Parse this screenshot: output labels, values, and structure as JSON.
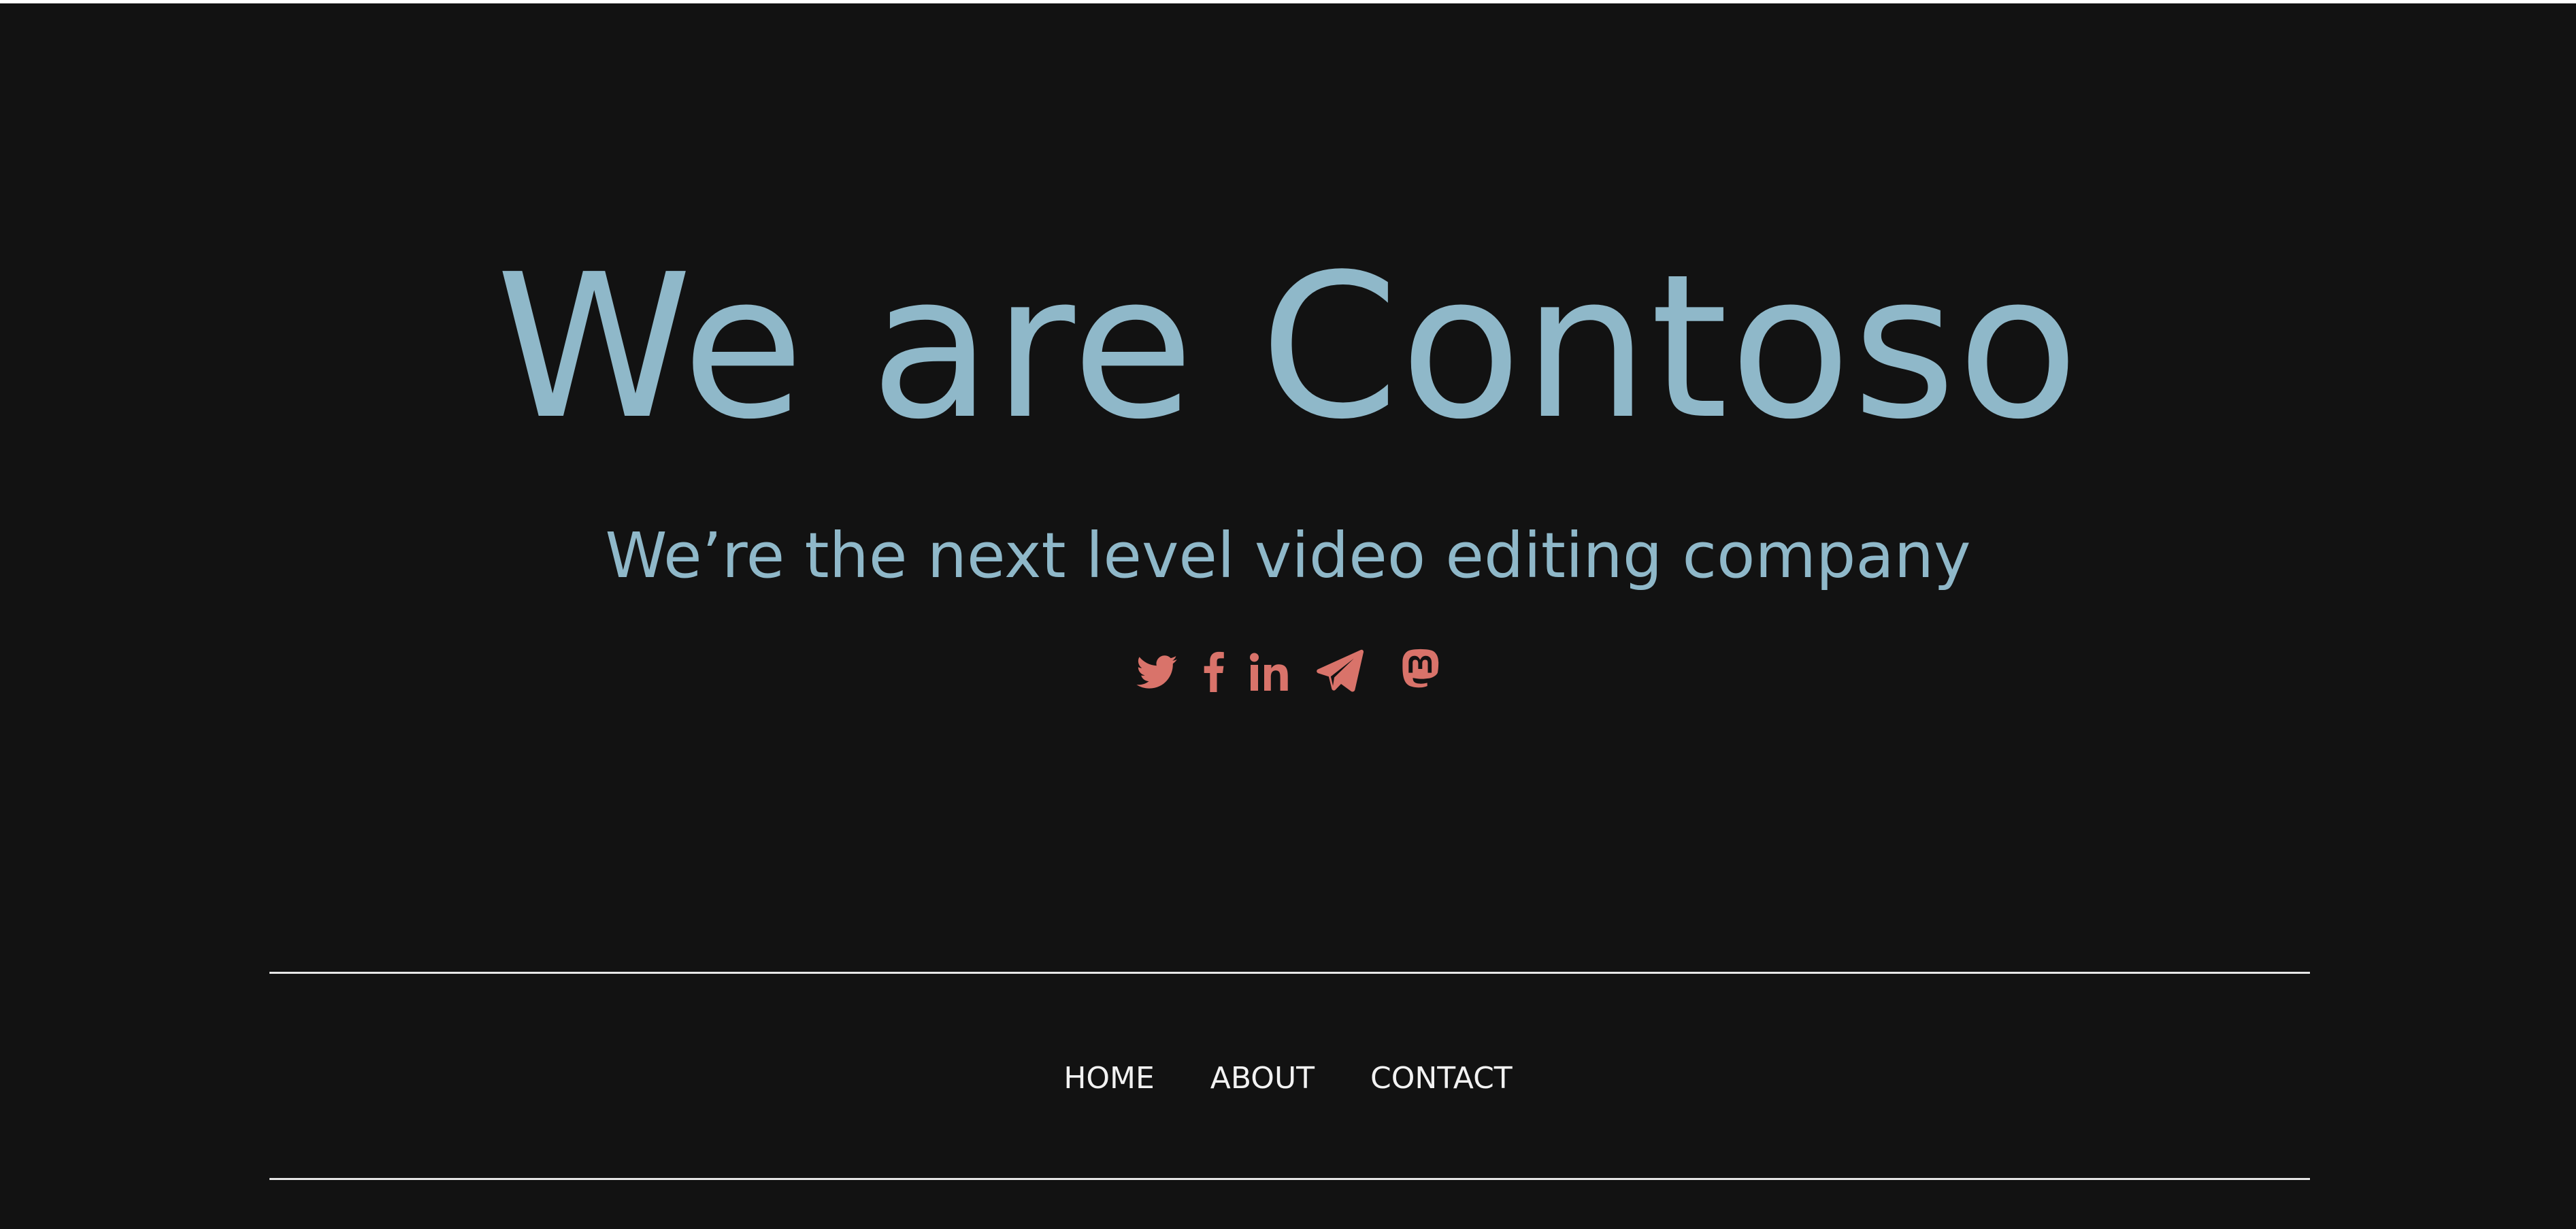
{
  "hero": {
    "title": "We are Contoso",
    "subtitle": "We’re the next level video editing company"
  },
  "social": {
    "icons": [
      "twitter-icon",
      "facebook-icon",
      "linkedin-icon",
      "telegram-icon",
      "mastodon-icon"
    ],
    "icon_color": "#d9736a"
  },
  "nav": {
    "items": [
      {
        "label": "HOME"
      },
      {
        "label": "ABOUT"
      },
      {
        "label": "CONTACT"
      }
    ]
  },
  "colors": {
    "background": "#121212",
    "heading": "#8fb8c9",
    "nav_text": "#f2f2f2",
    "rule": "#e6e6e6"
  }
}
